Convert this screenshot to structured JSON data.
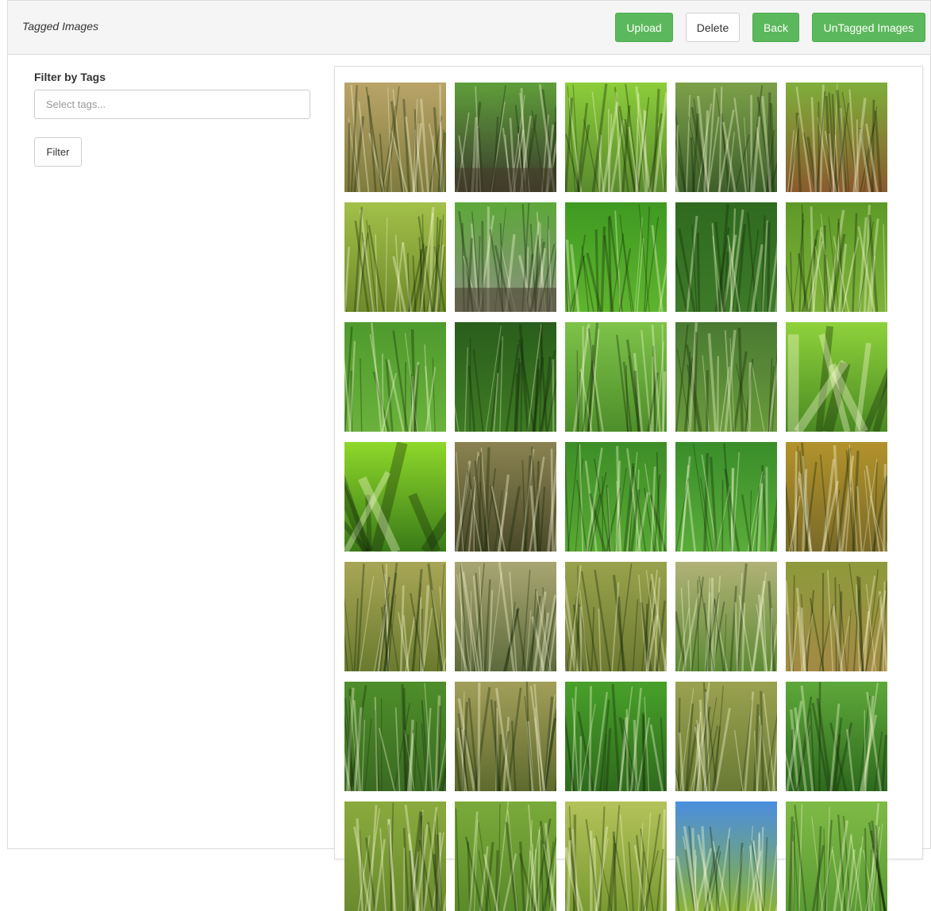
{
  "header": {
    "title": "Tagged Images",
    "buttons": {
      "upload": "Upload",
      "delete": "Delete",
      "back": "Back",
      "untagged": "UnTagged Images"
    }
  },
  "filter": {
    "label": "Filter by Tags",
    "placeholder": "Select tags...",
    "button": "Filter"
  },
  "colors": {
    "primary_green": "#5cb85c",
    "heading_bg": "#f5f5f5"
  },
  "gallery": {
    "columns": 5,
    "thumbnails": [
      {
        "c1": "#b9a468",
        "c2": "#7f7b3e",
        "style": "grass"
      },
      {
        "c1": "#5f9e3a",
        "c2": "#3b3a2e",
        "style": "field-water"
      },
      {
        "c1": "#8ccd3a",
        "c2": "#5a8a2e",
        "style": "grass"
      },
      {
        "c1": "#7da04a",
        "c2": "#3d5e2a",
        "style": "grass"
      },
      {
        "c1": "#7fae3a",
        "c2": "#8a5a2e",
        "style": "grass"
      },
      {
        "c1": "#a2c04a",
        "c2": "#6e8a2a",
        "style": "grass"
      },
      {
        "c1": "#5da83a",
        "c2": "#8a8f7f",
        "style": "field-water"
      },
      {
        "c1": "#3f9a22",
        "c2": "#5fb42e",
        "style": "blades"
      },
      {
        "c1": "#2f6a20",
        "c2": "#3d7a28",
        "style": "blades"
      },
      {
        "c1": "#5e9a28",
        "c2": "#7eb23a",
        "style": "grass"
      },
      {
        "c1": "#4f9a2e",
        "c2": "#6ab23c",
        "style": "blades"
      },
      {
        "c1": "#2a5e1c",
        "c2": "#3e7a24",
        "style": "blades"
      },
      {
        "c1": "#7ec24a",
        "c2": "#4e8e2a",
        "style": "blades"
      },
      {
        "c1": "#4a7a32",
        "c2": "#6a9a3c",
        "style": "blades"
      },
      {
        "c1": "#8fd23c",
        "c2": "#4a8a22",
        "style": "leaves"
      },
      {
        "c1": "#8ed82a",
        "c2": "#3a7a18",
        "style": "leaves"
      },
      {
        "c1": "#8a8250",
        "c2": "#4a4a2a",
        "style": "grass"
      },
      {
        "c1": "#3e8e28",
        "c2": "#58a834",
        "style": "grass"
      },
      {
        "c1": "#3a8e2a",
        "c2": "#5aac3a",
        "style": "blades"
      },
      {
        "c1": "#b2922c",
        "c2": "#7a6a28",
        "style": "grass"
      },
      {
        "c1": "#a8a656",
        "c2": "#6a7a2e",
        "style": "grass"
      },
      {
        "c1": "#a8a672",
        "c2": "#5e6a3c",
        "style": "grass"
      },
      {
        "c1": "#98a24c",
        "c2": "#6e7a32",
        "style": "grass"
      },
      {
        "c1": "#b0b276",
        "c2": "#5e8a36",
        "style": "grass"
      },
      {
        "c1": "#8e9a3c",
        "c2": "#a28a44",
        "style": "grass"
      },
      {
        "c1": "#4e8e2a",
        "c2": "#3a6a22",
        "style": "grass"
      },
      {
        "c1": "#a29e5a",
        "c2": "#5e6a2e",
        "style": "grass"
      },
      {
        "c1": "#48a02a",
        "c2": "#2f6a1e",
        "style": "blades"
      },
      {
        "c1": "#9aa250",
        "c2": "#6a7a34",
        "style": "grass"
      },
      {
        "c1": "#5ea83a",
        "c2": "#2e6a1e",
        "style": "blades"
      },
      {
        "c1": "#8aaa3e",
        "c2": "#6a8a2e",
        "style": "grass"
      },
      {
        "c1": "#7aaa3a",
        "c2": "#5a8a2a",
        "style": "grass"
      },
      {
        "c1": "#b4c25a",
        "c2": "#7a9a32",
        "style": "grass"
      },
      {
        "c1": "#4a8ee0",
        "c2": "#8ab23a",
        "style": "sky"
      },
      {
        "c1": "#7eba46",
        "c2": "#5a9a32",
        "style": "grass"
      }
    ]
  }
}
